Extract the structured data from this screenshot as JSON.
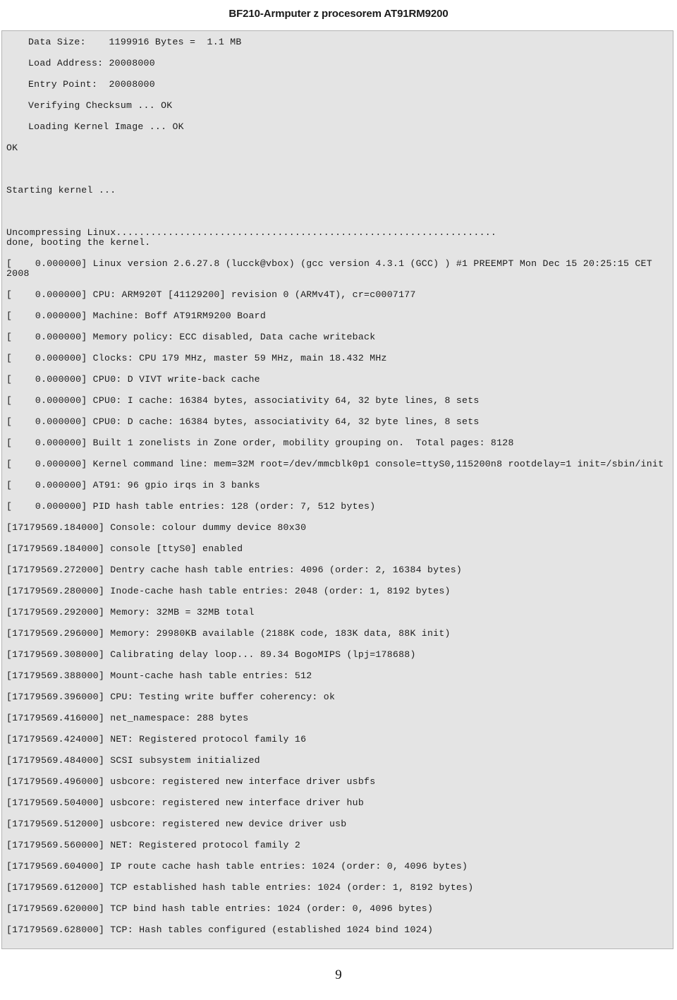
{
  "header": {
    "title": "BF210-Armputer z procesorem AT91RM9200"
  },
  "footer": {
    "page_number": "9"
  },
  "colors": {
    "page_background": "#ffffff",
    "console_background": "#e4e4e4",
    "console_border": "#b4b4b4",
    "text": "#1c1c1c",
    "header_text": "#1a1a1a"
  },
  "console": {
    "lines": [
      {
        "id": "l01",
        "indent": true,
        "pitch": true,
        "text": "Data Size:    1199916 Bytes =  1.1 MB"
      },
      {
        "id": "l02",
        "indent": true,
        "pitch": true,
        "text": "Load Address: 20008000"
      },
      {
        "id": "l03",
        "indent": true,
        "pitch": true,
        "text": "Entry Point:  20008000"
      },
      {
        "id": "l04",
        "indent": true,
        "pitch": true,
        "text": "Verifying Checksum ... OK"
      },
      {
        "id": "l05",
        "indent": true,
        "pitch": true,
        "text": "Loading Kernel Image ... OK"
      },
      {
        "id": "l06",
        "indent": false,
        "pitch": true,
        "text": "OK"
      },
      {
        "id": "l07",
        "indent": false,
        "pitch": true,
        "text": ""
      },
      {
        "id": "l08",
        "indent": false,
        "pitch": true,
        "text": "Starting kernel ..."
      },
      {
        "id": "l09",
        "indent": false,
        "pitch": true,
        "text": ""
      },
      {
        "id": "l10",
        "indent": false,
        "pitch": false,
        "text": "Uncompressing Linux.................................................................."
      },
      {
        "id": "l11",
        "indent": false,
        "pitch": true,
        "text": "done, booting the kernel."
      },
      {
        "id": "l12",
        "indent": false,
        "pitch": true,
        "text": "[    0.000000] Linux version 2.6.27.8 (lucck@vbox) (gcc version 4.3.1 (GCC) ) #1 PREEMPT Mon Dec 15 20:25:15 CET 2008"
      },
      {
        "id": "l13",
        "indent": false,
        "pitch": true,
        "text": "[    0.000000] CPU: ARM920T [41129200] revision 0 (ARMv4T), cr=c0007177"
      },
      {
        "id": "l14",
        "indent": false,
        "pitch": true,
        "text": "[    0.000000] Machine: Boff AT91RM9200 Board"
      },
      {
        "id": "l15",
        "indent": false,
        "pitch": true,
        "text": "[    0.000000] Memory policy: ECC disabled, Data cache writeback"
      },
      {
        "id": "l16",
        "indent": false,
        "pitch": true,
        "text": "[    0.000000] Clocks: CPU 179 MHz, master 59 MHz, main 18.432 MHz"
      },
      {
        "id": "l17",
        "indent": false,
        "pitch": true,
        "text": "[    0.000000] CPU0: D VIVT write-back cache"
      },
      {
        "id": "l18",
        "indent": false,
        "pitch": true,
        "text": "[    0.000000] CPU0: I cache: 16384 bytes, associativity 64, 32 byte lines, 8 sets"
      },
      {
        "id": "l19",
        "indent": false,
        "pitch": true,
        "text": "[    0.000000] CPU0: D cache: 16384 bytes, associativity 64, 32 byte lines, 8 sets"
      },
      {
        "id": "l20",
        "indent": false,
        "pitch": true,
        "text": "[    0.000000] Built 1 zonelists in Zone order, mobility grouping on.  Total pages: 8128"
      },
      {
        "id": "l21",
        "indent": false,
        "pitch": true,
        "text": "[    0.000000] Kernel command line: mem=32M root=/dev/mmcblk0p1 console=ttyS0,115200n8 rootdelay=1 init=/sbin/init"
      },
      {
        "id": "l22",
        "indent": false,
        "pitch": true,
        "text": "[    0.000000] AT91: 96 gpio irqs in 3 banks"
      },
      {
        "id": "l23",
        "indent": false,
        "pitch": true,
        "text": "[    0.000000] PID hash table entries: 128 (order: 7, 512 bytes)"
      },
      {
        "id": "l24",
        "indent": false,
        "pitch": true,
        "text": "[17179569.184000] Console: colour dummy device 80x30"
      },
      {
        "id": "l25",
        "indent": false,
        "pitch": true,
        "text": "[17179569.184000] console [ttyS0] enabled"
      },
      {
        "id": "l26",
        "indent": false,
        "pitch": true,
        "text": "[17179569.272000] Dentry cache hash table entries: 4096 (order: 2, 16384 bytes)"
      },
      {
        "id": "l27",
        "indent": false,
        "pitch": true,
        "text": "[17179569.280000] Inode-cache hash table entries: 2048 (order: 1, 8192 bytes)"
      },
      {
        "id": "l28",
        "indent": false,
        "pitch": true,
        "text": "[17179569.292000] Memory: 32MB = 32MB total"
      },
      {
        "id": "l29",
        "indent": false,
        "pitch": true,
        "text": "[17179569.296000] Memory: 29980KB available (2188K code, 183K data, 88K init)"
      },
      {
        "id": "l30",
        "indent": false,
        "pitch": true,
        "text": "[17179569.308000] Calibrating delay loop... 89.34 BogoMIPS (lpj=178688)"
      },
      {
        "id": "l31",
        "indent": false,
        "pitch": true,
        "text": "[17179569.388000] Mount-cache hash table entries: 512"
      },
      {
        "id": "l32",
        "indent": false,
        "pitch": true,
        "text": "[17179569.396000] CPU: Testing write buffer coherency: ok"
      },
      {
        "id": "l33",
        "indent": false,
        "pitch": true,
        "text": "[17179569.416000] net_namespace: 288 bytes"
      },
      {
        "id": "l34",
        "indent": false,
        "pitch": true,
        "text": "[17179569.424000] NET: Registered protocol family 16"
      },
      {
        "id": "l35",
        "indent": false,
        "pitch": true,
        "text": "[17179569.484000] SCSI subsystem initialized"
      },
      {
        "id": "l36",
        "indent": false,
        "pitch": true,
        "text": "[17179569.496000] usbcore: registered new interface driver usbfs"
      },
      {
        "id": "l37",
        "indent": false,
        "pitch": true,
        "text": "[17179569.504000] usbcore: registered new interface driver hub"
      },
      {
        "id": "l38",
        "indent": false,
        "pitch": true,
        "text": "[17179569.512000] usbcore: registered new device driver usb"
      },
      {
        "id": "l39",
        "indent": false,
        "pitch": true,
        "text": "[17179569.560000] NET: Registered protocol family 2"
      },
      {
        "id": "l40",
        "indent": false,
        "pitch": true,
        "text": "[17179569.604000] IP route cache hash table entries: 1024 (order: 0, 4096 bytes)"
      },
      {
        "id": "l41",
        "indent": false,
        "pitch": true,
        "text": "[17179569.612000] TCP established hash table entries: 1024 (order: 1, 8192 bytes)"
      },
      {
        "id": "l42",
        "indent": false,
        "pitch": true,
        "text": "[17179569.620000] TCP bind hash table entries: 1024 (order: 0, 4096 bytes)"
      },
      {
        "id": "l43",
        "indent": false,
        "pitch": false,
        "text": "[17179569.628000] TCP: Hash tables configured (established 1024 bind 1024)"
      }
    ]
  }
}
